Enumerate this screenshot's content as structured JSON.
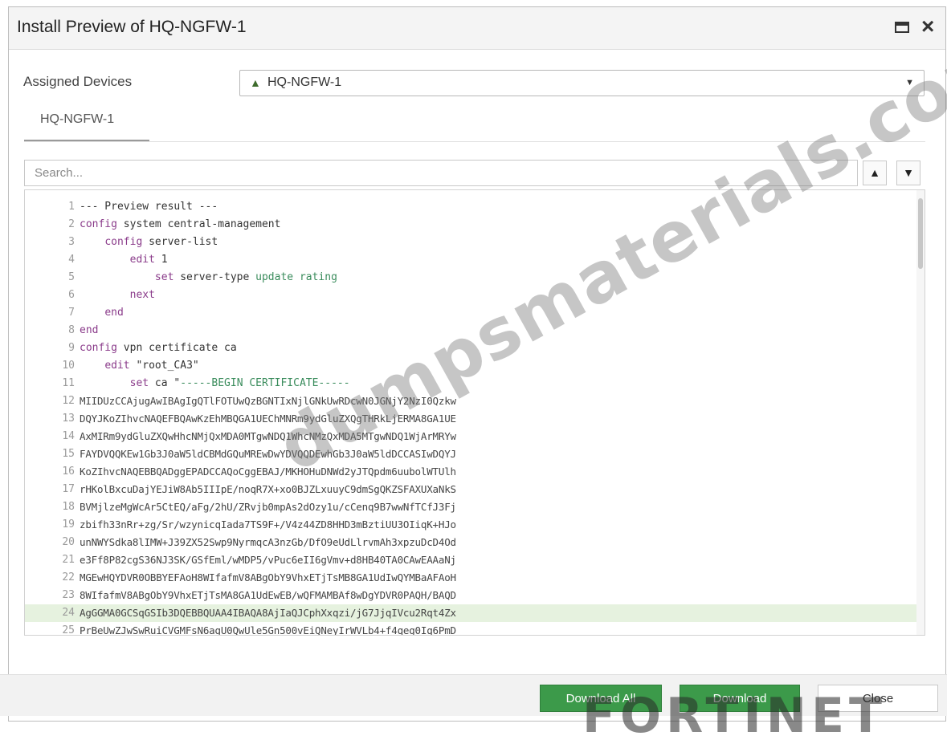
{
  "window": {
    "title": "Install Preview of HQ-NGFW-1",
    "maximize_icon": "window-maximize-icon",
    "close_symbol": "×"
  },
  "assigned_devices": {
    "label": "Assigned Devices",
    "selected": "HQ-NGFW-1",
    "icon": "up-arrow-icon"
  },
  "tabs": [
    {
      "label": "HQ-NGFW-1",
      "active": true
    }
  ],
  "search": {
    "placeholder": "Search...",
    "prev_symbol": "▲",
    "next_symbol": "▼"
  },
  "preview_lines": [
    {
      "num": "1",
      "text": "--- Preview result ---"
    },
    {
      "num": "2",
      "text": "config system central-management"
    },
    {
      "num": "3",
      "text": "    config server-list"
    },
    {
      "num": "4",
      "text": "        edit 1"
    },
    {
      "num": "5",
      "text": "            set server-type update rating"
    },
    {
      "num": "6",
      "text": "        next"
    },
    {
      "num": "7",
      "text": "    end"
    },
    {
      "num": "8",
      "text": "end"
    },
    {
      "num": "9",
      "text": "config vpn certificate ca"
    },
    {
      "num": "10",
      "text": "    edit \"root_CA3\""
    },
    {
      "num": "11",
      "text": "        set ca \"-----BEGIN CERTIFICATE-----"
    },
    {
      "num": "12",
      "text": "MIIDUzCCAjugAwIBAgIgQTlFOTUwQzBGNTIxNjlGNkUwRDcwN0JGNjY2NzI0Qzkw"
    },
    {
      "num": "13",
      "text": "DQYJKoZIhvcNAQEFBQAwKzEhMBQGA1UEChMNRm9ydGluZXQgTHRkLjERMA8GA1UE"
    },
    {
      "num": "14",
      "text": "AxMIRm9ydGluZXQwHhcNMjQxMDA0MTgwNDQ1WhcNMzQxMDA5MTgwNDQ1WjArMRYw"
    },
    {
      "num": "15",
      "text": "FAYDVQQKEw1Gb3J0aW5ldCBMdGQuMREwDwYDVQQDEwhGb3J0aW5ldDCCASIwDQYJ"
    },
    {
      "num": "16",
      "text": "KoZIhvcNAQEBBQADggEPADCCAQoCggEBAJ/MKHOHuDNWd2yJTQpdm6uubolWTUlh"
    },
    {
      "num": "17",
      "text": "rHKolBxcuDajYEJiW8Ab5IIIpE/noqR7X+xo0BJZLxuuyC9dmSgQKZSFAXUXaNkS"
    },
    {
      "num": "18",
      "text": "BVMjlzeMgWcAr5CtEQ/aFg/2hU/ZRvjb0mpAs2dOzy1u/cCenq9B7wwNfTCfJ3Fj"
    },
    {
      "num": "19",
      "text": "zbifh33nRr+zg/Sr/wzynicqIada7TS9F+/V4z44ZD8HHD3mBztiUU3OIiqK+HJo"
    },
    {
      "num": "20",
      "text": "unNWYSdka8lIMW+J39ZX52Swp9NyrmqcA3nzGb/DfO9eUdLlrvmAh3xpzuDcD4Od"
    },
    {
      "num": "21",
      "text": "e3Ff8P82cgS36NJ3SK/GSfEml/wMDP5/vPuc6eII6gVmv+d8HB40TA0CAwEAAaNj"
    },
    {
      "num": "22",
      "text": "MGEwHQYDVR0OBBYEFAoH8WIfafmV8ABgObY9VhxETjTsMB8GA1UdIwQYMBaAFAoH"
    },
    {
      "num": "23",
      "text": "8WIfafmV8ABgObY9VhxETjTsMA8GA1UdEwEB/wQFMAMBAf8wDgYDVR0PAQH/BAQD"
    },
    {
      "num": "24",
      "text": "AgGGMA0GCSqGSIb3DQEBBQUAA4IBAQA8AjIaQJCphXxqzi/jG7JjqIVcu2Rqt4Zx"
    },
    {
      "num": "25",
      "text": "PrBeUwZJwSwRuiCVGMFsN6agU0QwUle5Gn500vEiQNeyIrWVLb4+f4qeg0Iq6PmD"
    }
  ],
  "highlighted_line": "24",
  "buttons": {
    "download_all": "Download All",
    "download": "Download",
    "close": "Close"
  },
  "colors": {
    "primary_button": "#3c9a4a",
    "keyword": "#8a3b8a",
    "string": "#3a8c5c",
    "highlight_row": "#e6f2df"
  },
  "watermark": "dumpsmaterials.com",
  "brand_logo": "FORTINET"
}
